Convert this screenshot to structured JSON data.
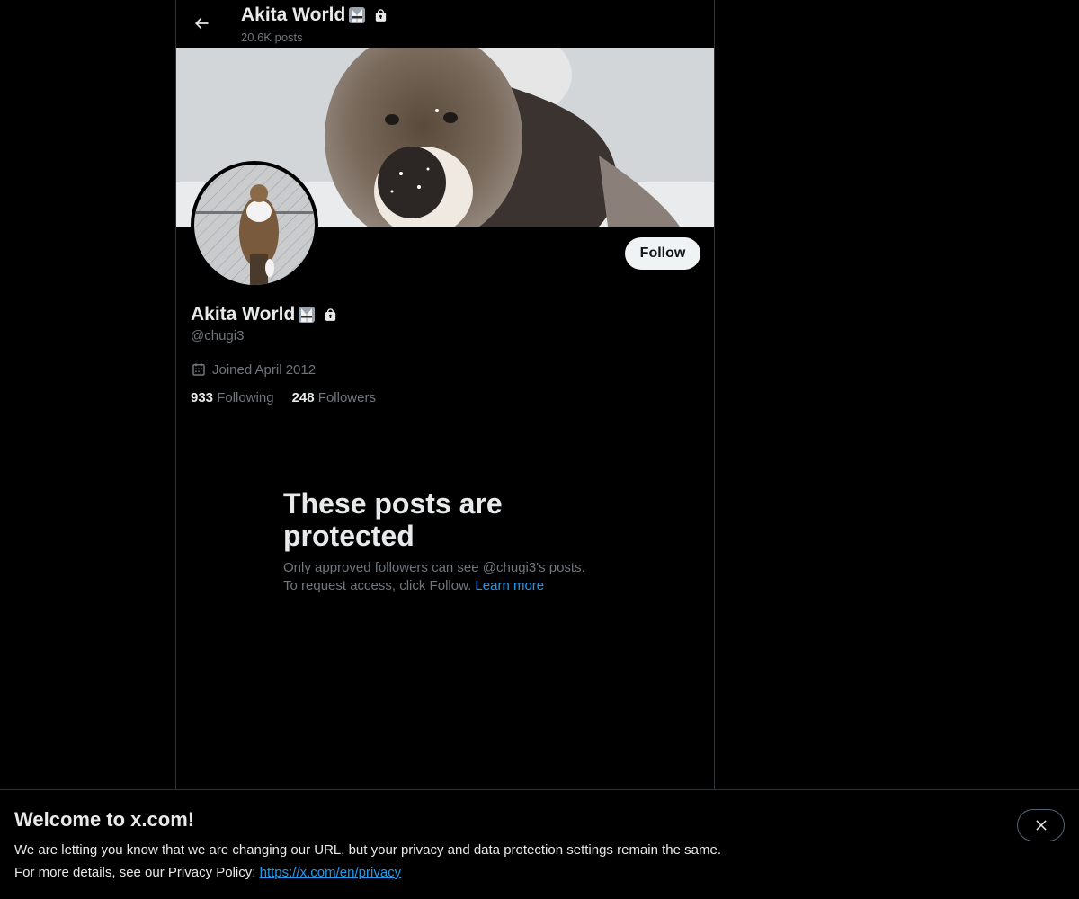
{
  "header": {
    "display_name": "Akita World",
    "post_count": "20.6K posts"
  },
  "profile": {
    "display_name": "Akita World",
    "handle": "@chugi3",
    "joined": "Joined April 2012",
    "following_count": "933",
    "following_label": "Following",
    "followers_count": "248",
    "followers_label": "Followers",
    "follow_label": "Follow"
  },
  "protected": {
    "title": "These posts are protected",
    "line1": "Only approved followers can see @chugi3's posts.",
    "line2_prefix": "To request access, click Follow.",
    "learn_more": "Learn more"
  },
  "notice": {
    "title": "Welcome to x.com!",
    "line1": "We are letting you know that we are changing our URL, but your privacy and data protection settings remain the same.",
    "line2_prefix": "For more details, see our Privacy Policy:",
    "link": "https://x.com/en/privacy"
  },
  "icons": {
    "back": "arrow-left-icon",
    "emoji": "karate-uniform-emoji",
    "lock": "lock-icon",
    "calendar": "calendar-icon",
    "close": "close-icon"
  },
  "colors": {
    "background": "#000000",
    "text_primary": "#e7e9ea",
    "text_secondary": "#71767b",
    "link": "#1d9bf0",
    "border": "#2f3336",
    "follow_button_bg": "#eff3f4"
  }
}
